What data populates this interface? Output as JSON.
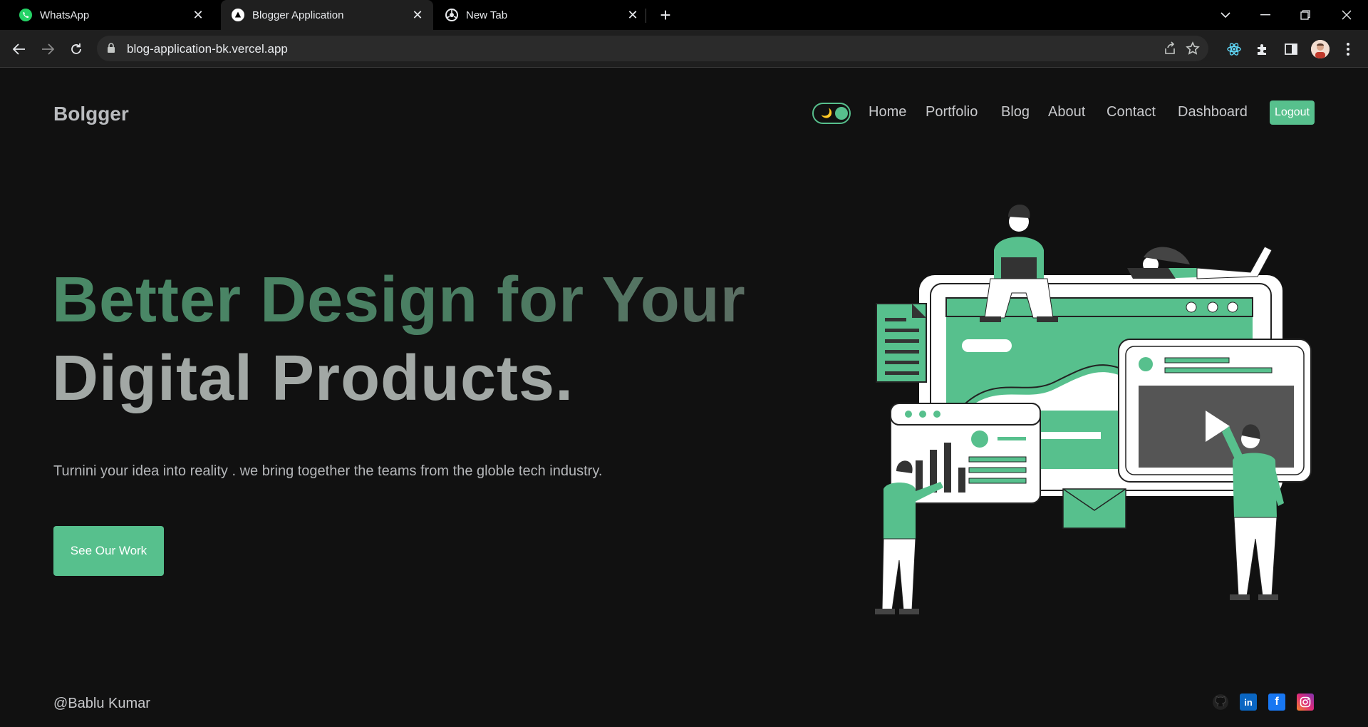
{
  "browser": {
    "tabs": [
      {
        "title": "WhatsApp",
        "icon": "whatsapp-icon"
      },
      {
        "title": "Blogger Application",
        "icon": "vercel-icon",
        "active": true
      },
      {
        "title": "New Tab",
        "icon": "chrome-icon"
      }
    ],
    "url": "blog-application-bk.vercel.app"
  },
  "header": {
    "brand": "Bolgger",
    "nav": [
      "Home",
      "Portfolio",
      "Blog",
      "About",
      "Contact",
      "Dashboard"
    ],
    "logout_label": "Logout",
    "theme_toggle_icon": "🌙"
  },
  "hero": {
    "title_line1": "Better Design for Your",
    "title_line2": "Digital Products.",
    "subtitle": "Turnini your idea into reality . we bring together the teams from the globle tech industry.",
    "cta_label": "See Our Work"
  },
  "footer": {
    "author": "@Bablu Kumar",
    "socials": [
      "github-icon",
      "linkedin-icon",
      "facebook-icon",
      "instagram-icon"
    ]
  },
  "colors": {
    "accent": "#57c08d",
    "background": "#111111",
    "text_muted": "#c8c9cc"
  }
}
